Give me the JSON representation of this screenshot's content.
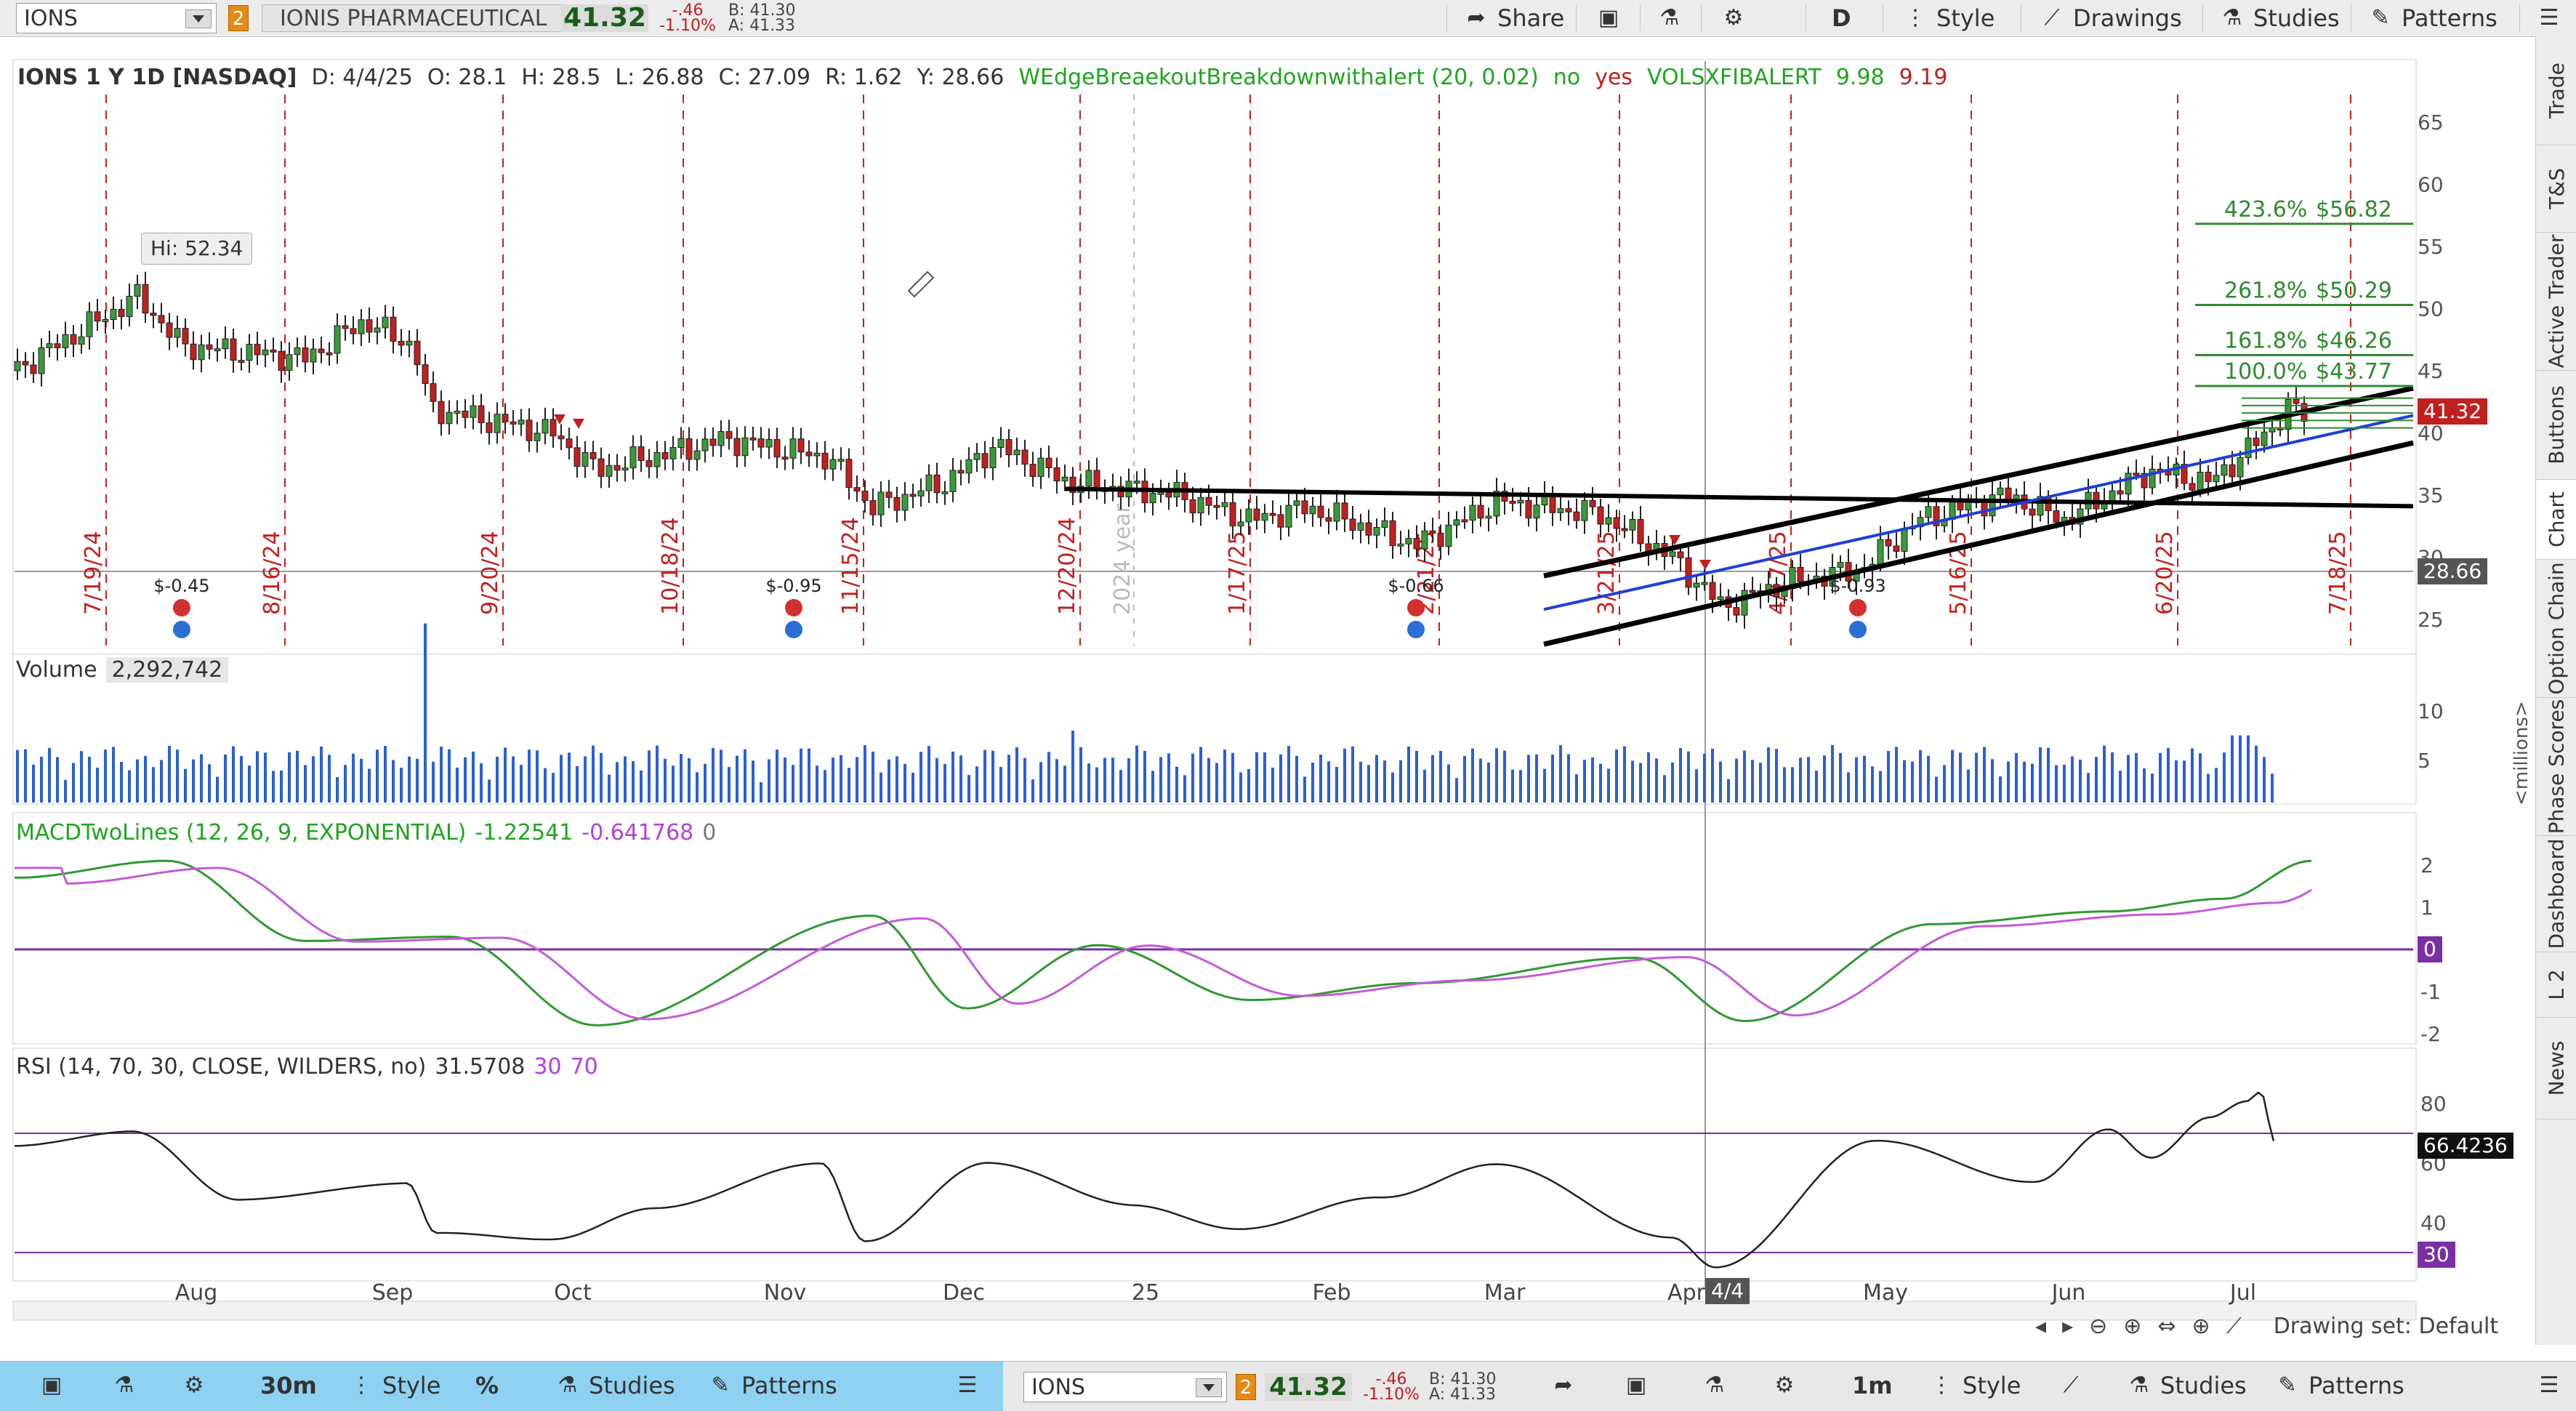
{
  "top_toolbar": {
    "symbol": "IONS",
    "link_number": "2",
    "company": "IONIS PHARMACEUTICAL",
    "last": "41.32",
    "change": "-.46",
    "change_pct": "-1.10%",
    "bid": "B: 41.30",
    "ask": "A: 41.33",
    "share_label": "Share",
    "period_label": "D",
    "style_label": "Style",
    "drawings_label": "Drawings",
    "studies_label": "Studies",
    "patterns_label": "Patterns"
  },
  "info_line": {
    "title": "IONS 1 Y 1D [NASDAQ]",
    "date": "D: 4/4/25",
    "open": "O: 28.1",
    "high": "H: 28.5",
    "low": "L: 26.88",
    "close": "C: 27.09",
    "range": "R: 1.62",
    "y": "Y: 28.66",
    "study1": "WEdgeBreaekoutBreakdownwithalert (20, 0.02)",
    "study1_no": "no",
    "study1_yes": "yes",
    "study2": "VOLSXFIBALERT",
    "study2_v1": "9.98",
    "study2_v2": "9.19"
  },
  "price_panel": {
    "hi_label": "Hi: 52.34",
    "yaxis": [
      "65",
      "60",
      "55",
      "50",
      "45",
      "40",
      "35",
      "30",
      "25"
    ],
    "last_tag": "41.32",
    "cursor_tag": "28.66",
    "fib_levels": [
      {
        "pct": "423.6%",
        "price": "$56.82"
      },
      {
        "pct": "261.8%",
        "price": "$50.29"
      },
      {
        "pct": "161.8%",
        "price": "$46.26"
      },
      {
        "pct": "100.0%",
        "price": "$43.77"
      }
    ],
    "event_dates": [
      "7/19/24",
      "8/16/24",
      "9/20/24",
      "10/18/24",
      "11/15/24",
      "12/20/24",
      "1/17/25",
      "2/21/25",
      "3/21/25",
      "4/17/25",
      "5/16/25",
      "6/20/25",
      "7/18/25"
    ],
    "year_marker": "2024 year",
    "dividends": [
      "$-0.45",
      "$-0.95",
      "$-0.66",
      "$-0.93"
    ],
    "colors": {
      "up": "#3a9a3a",
      "down": "#c21f1f",
      "trend": "#000000",
      "channel_mid": "#1f3fd6",
      "fib": "#2e8b2e"
    }
  },
  "volume_panel": {
    "label": "Volume",
    "value": "2,292,742",
    "yaxis": [
      "10",
      "5"
    ],
    "unit": "<millions>"
  },
  "macd_panel": {
    "label": "MACDTwoLines (12, 26, 9, EXPONENTIAL)",
    "v1": "-1.22541",
    "v2": "-0.641768",
    "v3": "0",
    "yaxis": [
      "2",
      "1",
      "-1",
      "-2"
    ],
    "zero_tag": "0"
  },
  "rsi_panel": {
    "label": "RSI (14, 70, 30, CLOSE, WILDERS, no)",
    "value": "31.5708",
    "lo": "30",
    "hi": "70",
    "yaxis": [
      "80",
      "60",
      "40"
    ],
    "value_tag": "66.4236",
    "lo_tag": "30"
  },
  "xaxis": {
    "months": [
      "Aug",
      "Sep",
      "Oct",
      "Nov",
      "Dec",
      "25",
      "Feb",
      "Mar",
      "Apr",
      "May",
      "Jun",
      "Jul"
    ],
    "cursor_date": "4/4"
  },
  "bottom_strip": {
    "drawing_set": "Drawing set: Default"
  },
  "right_tabs": [
    "Trade",
    "T&S",
    "Active Trader",
    "Buttons",
    "Chart",
    "Option Chain",
    "Phase Scores",
    "Dashboard",
    "L 2",
    "News"
  ],
  "bottom_toolbar": {
    "left": {
      "period": "30m",
      "style_label": "Style",
      "pct_label": "%",
      "studies_label": "Studies",
      "patterns_label": "Patterns"
    },
    "right": {
      "symbol": "IONS",
      "link_number": "2",
      "last": "41.32",
      "change": "-.46",
      "change_pct": "-1.10%",
      "bid": "B: 41.30",
      "ask": "A: 41.33",
      "period": "1m",
      "style_label": "Style",
      "studies_label": "Studies",
      "patterns_label": "Patterns"
    }
  }
}
